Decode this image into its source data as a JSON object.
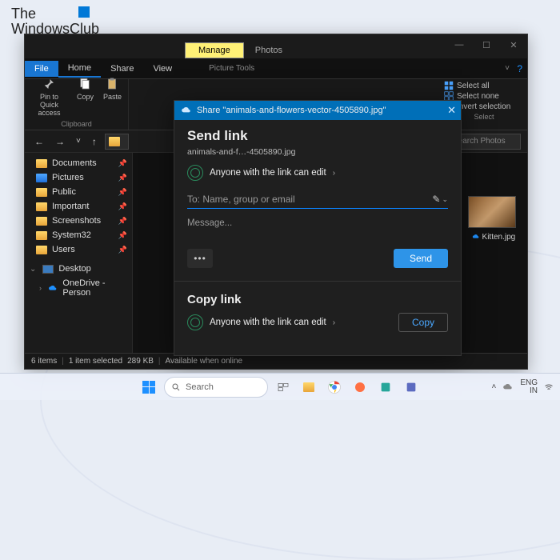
{
  "watermark": {
    "line1": "The",
    "line2": "WindowsClub"
  },
  "explorer": {
    "context_tab": "Manage",
    "photos_tab": "Photos",
    "tabs": {
      "file": "File",
      "home": "Home",
      "share": "Share",
      "view": "View",
      "ptools": "Picture Tools"
    },
    "ribbon": {
      "pin": "Pin to Quick\naccess",
      "copy": "Copy",
      "paste": "Paste",
      "clipboard_label": "Clipboard",
      "select_all": "Select all",
      "select_none": "Select none",
      "invert": "Invert selection",
      "select_label": "Select"
    },
    "search_placeholder": "Search Photos",
    "sidebar": {
      "items": [
        {
          "label": "Documents",
          "pin": true,
          "icon": "folder"
        },
        {
          "label": "Pictures",
          "pin": true,
          "icon": "blue"
        },
        {
          "label": "Public",
          "pin": true,
          "icon": "folder"
        },
        {
          "label": "Important",
          "pin": true,
          "icon": "folder"
        },
        {
          "label": "Screenshots",
          "pin": true,
          "icon": "folder"
        },
        {
          "label": "System32",
          "pin": true,
          "icon": "folder"
        },
        {
          "label": "Users",
          "pin": true,
          "icon": "folder"
        }
      ],
      "desktop": "Desktop",
      "onedrive": "OneDrive - Person"
    },
    "thumb": {
      "label": "Kitten.jpg"
    },
    "status": {
      "items": "6 items",
      "selected": "1 item selected",
      "size": "289 KB",
      "avail": "Available when online"
    }
  },
  "share": {
    "title_prefix": "Share \"",
    "title_file": "animals-and-flowers-vector-4505890.jpg",
    "title_suffix": "\"",
    "heading": "Send link",
    "filename": "animals-and-f…-4505890.jpg",
    "perm": "Anyone with the link can edit",
    "to_placeholder": "To: Name, group or email",
    "message_placeholder": "Message...",
    "send": "Send",
    "copy_heading": "Copy link",
    "copy_perm": "Anyone with the link can edit",
    "copy": "Copy"
  },
  "taskbar": {
    "search": "Search",
    "lang1": "ENG",
    "lang2": "IN"
  }
}
